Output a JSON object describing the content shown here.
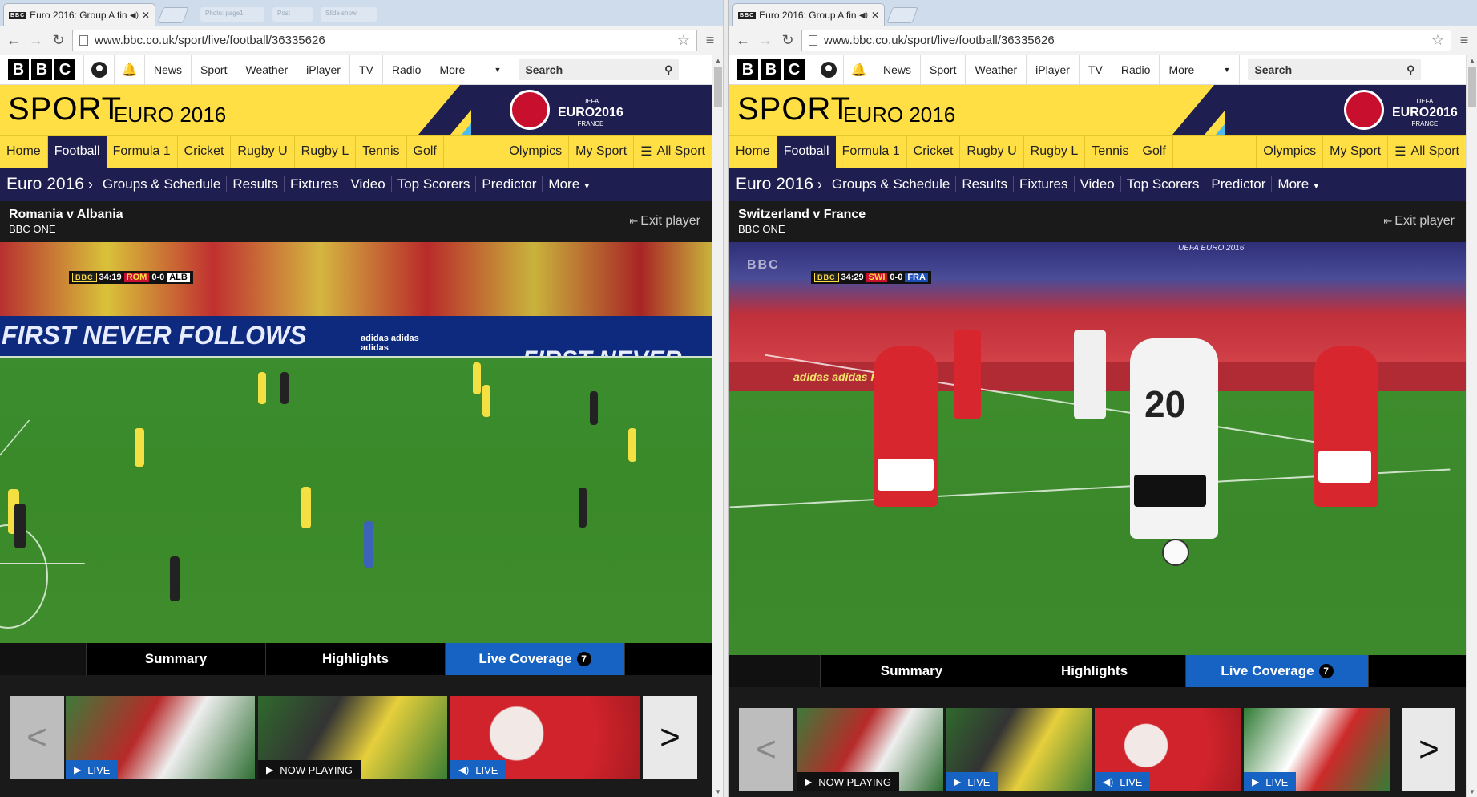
{
  "left": {
    "tab": {
      "title": "Euro 2016: Group A fin",
      "favicon": "BBC",
      "audio_icon": "speaker-icon",
      "close": "✕"
    },
    "blurred_tabs": [
      "Photo: page1",
      "Post",
      "Slide show"
    ],
    "url": "www.bbc.co.uk/sport/live/football/36335626",
    "bbc_nav": [
      "News",
      "Sport",
      "Weather",
      "iPlayer",
      "TV",
      "Radio"
    ],
    "bbc_more": "More",
    "search_placeholder": "Search",
    "sport_title": "SPORT",
    "sport_subtitle": "EURO 2016",
    "euro_logo": {
      "top": "UEFA",
      "main": "EURO2016",
      "bottom": "FRANCE"
    },
    "section_nav_left": [
      "Home",
      "Football",
      "Formula 1",
      "Cricket",
      "Rugby U",
      "Rugby L",
      "Tennis",
      "Golf"
    ],
    "section_nav_right": [
      "Olympics",
      "My Sport"
    ],
    "all_sport": "All Sport",
    "euro_nav_title": "Euro 2016",
    "euro_nav": [
      "Groups & Schedule",
      "Results",
      "Fixtures",
      "Video",
      "Top Scorers",
      "Predictor",
      "More"
    ],
    "player_title": "Romania v Albania",
    "player_channel": "BBC ONE",
    "exit_player": "Exit player",
    "hoarding_text": "FIRST NEVER FOLLOWS",
    "hoarding_text2": "adidas    adidas    adidas",
    "hoarding_text3": "FIRST NEVER",
    "scorebug": {
      "bbc": "BBC",
      "time": "34:19",
      "team_a": "ROM",
      "score": "0-0",
      "team_b": "ALB"
    },
    "tabs": [
      "Summary",
      "Highlights",
      "Live Coverage"
    ],
    "live_count": "7",
    "carousel": [
      {
        "badge": "LIVE",
        "kind": "live",
        "icon": "play-icon"
      },
      {
        "badge": "NOW PLAYING",
        "kind": "now",
        "icon": "play-icon"
      },
      {
        "badge": "LIVE",
        "kind": "live",
        "icon": "speaker-icon"
      }
    ],
    "prev_arrow": "<",
    "next_arrow": ">"
  },
  "right": {
    "tab": {
      "title": "Euro 2016: Group A fin",
      "favicon": "BBC",
      "audio_icon": "speaker-icon",
      "close": "✕"
    },
    "url": "www.bbc.co.uk/sport/live/football/36335626",
    "bbc_nav": [
      "News",
      "Sport",
      "Weather",
      "iPlayer",
      "TV",
      "Radio"
    ],
    "bbc_more": "More",
    "search_placeholder": "Search",
    "sport_title": "SPORT",
    "sport_subtitle": "EURO 2016",
    "euro_logo": {
      "top": "UEFA",
      "main": "EURO2016",
      "bottom": "FRANCE"
    },
    "section_nav_left": [
      "Home",
      "Football",
      "Formula 1",
      "Cricket",
      "Rugby U",
      "Rugby L",
      "Tennis",
      "Golf"
    ],
    "section_nav_right": [
      "Olympics",
      "My Sport"
    ],
    "all_sport": "All Sport",
    "euro_nav_title": "Euro 2016",
    "euro_nav": [
      "Groups & Schedule",
      "Results",
      "Fixtures",
      "Video",
      "Top Scorers",
      "Predictor",
      "More"
    ],
    "player_title": "Switzerland v France",
    "player_channel": "BBC ONE",
    "exit_player": "Exit player",
    "hoarding_text": "UEFA EURO 2016",
    "hoarding_text2": "adidas    adidas    FA EURO",
    "scorebug": {
      "bbc": "BBC",
      "time": "34:29",
      "team_a": "SWI",
      "score": "0-0",
      "team_b": "FRA"
    },
    "corner_logo": "BBC",
    "shirt_number": "20",
    "tabs": [
      "Summary",
      "Highlights",
      "Live Coverage"
    ],
    "live_count": "7",
    "carousel": [
      {
        "badge": "NOW PLAYING",
        "kind": "now",
        "icon": "play-icon"
      },
      {
        "badge": "LIVE",
        "kind": "live",
        "icon": "play-icon"
      },
      {
        "badge": "LIVE",
        "kind": "live",
        "icon": "speaker-icon"
      },
      {
        "badge": "LIVE",
        "kind": "live",
        "icon": "play-icon"
      }
    ],
    "prev_arrow": "<",
    "next_arrow": ">"
  },
  "colors": {
    "sport_yellow": "#ffdf43",
    "euro_navy": "#1e1e50",
    "live_blue": "#1763c4",
    "pitch_green": "#3d8a2a"
  }
}
